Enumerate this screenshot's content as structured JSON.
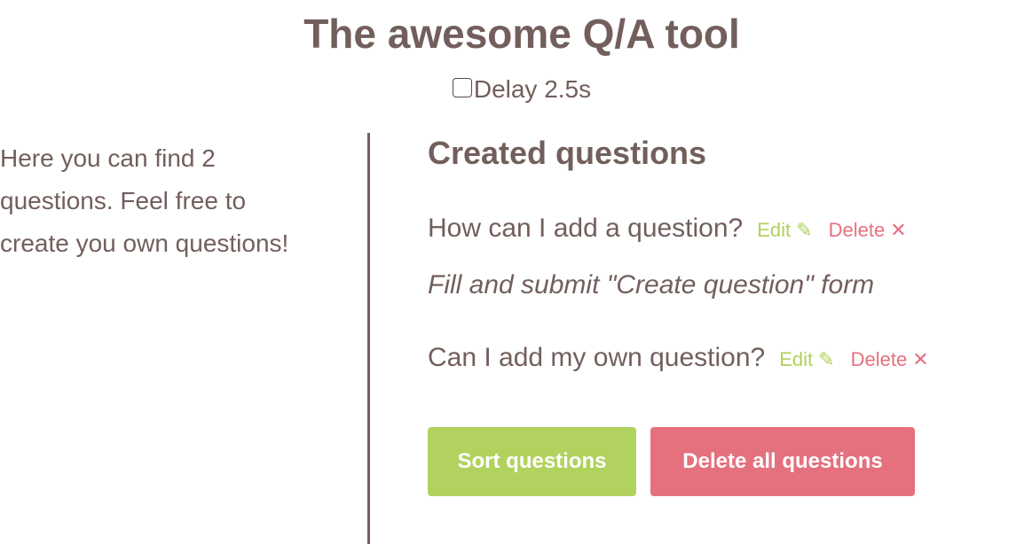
{
  "header": {
    "title": "The awesome Q/A tool",
    "delay_label": "Delay 2.5s",
    "delay_checked": false
  },
  "sidebar": {
    "text_line1": "Here you can find 2",
    "text_line2": "questions. Feel free to",
    "text_line3": "create you own questions!"
  },
  "main": {
    "section_title": "Created questions",
    "questions": [
      {
        "question": "How can I add a question?",
        "answer": "Fill and submit \"Create question\" form",
        "answer_visible": true
      },
      {
        "question": "Can I add my own question?",
        "answer": "",
        "answer_visible": false
      }
    ],
    "edit_label": "Edit",
    "delete_label": "Delete",
    "sort_button": "Sort questions",
    "delete_all_button": "Delete all questions"
  },
  "icons": {
    "edit": "pencil-icon",
    "delete": "close-icon"
  },
  "colors": {
    "text": "#725f5c",
    "edit": "#b0d15e",
    "delete": "#e5707e",
    "sort_button_bg": "#b1d25f",
    "delete_all_button_bg": "#e5707e"
  }
}
